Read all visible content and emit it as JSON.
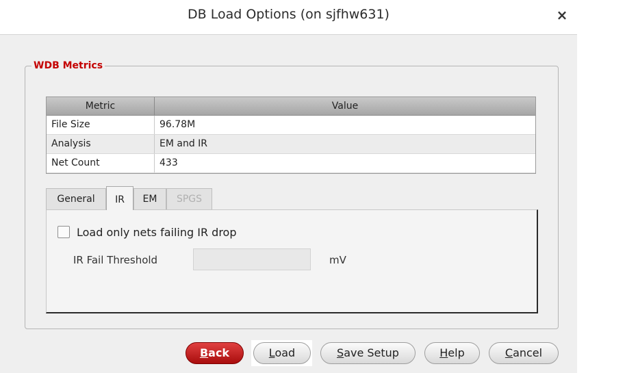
{
  "window": {
    "title": "DB Load Options (on sjfhw631)",
    "close_symbol": "×"
  },
  "group": {
    "title": "WDB Metrics"
  },
  "metrics_table": {
    "headers": [
      "Metric",
      "Value"
    ],
    "rows": [
      [
        "File Size",
        "96.78M"
      ],
      [
        "Analysis",
        "EM and IR"
      ],
      [
        "Net Count",
        "433"
      ]
    ]
  },
  "tabs": [
    {
      "label": "General",
      "active": false,
      "disabled": false
    },
    {
      "label": "IR",
      "active": true,
      "disabled": false
    },
    {
      "label": "EM",
      "active": false,
      "disabled": false
    },
    {
      "label": "SPGS",
      "active": false,
      "disabled": true
    }
  ],
  "ir_panel": {
    "checkbox_label": "Load only nets failing IR drop",
    "checkbox_checked": false,
    "threshold_label": "IR Fail Threshold",
    "threshold_value": "",
    "threshold_unit": "mV"
  },
  "buttons": {
    "back": {
      "mnemonic": "B",
      "rest": "ack"
    },
    "load": {
      "mnemonic": "L",
      "rest": "oad"
    },
    "save_setup": {
      "mnemonic": "S",
      "rest": "ave Setup"
    },
    "help": {
      "mnemonic": "H",
      "rest": "elp"
    },
    "cancel": {
      "mnemonic": "C",
      "rest": "ancel"
    }
  },
  "colors": {
    "accent_red": "#c40000",
    "primary_button": "#c01e1e"
  }
}
